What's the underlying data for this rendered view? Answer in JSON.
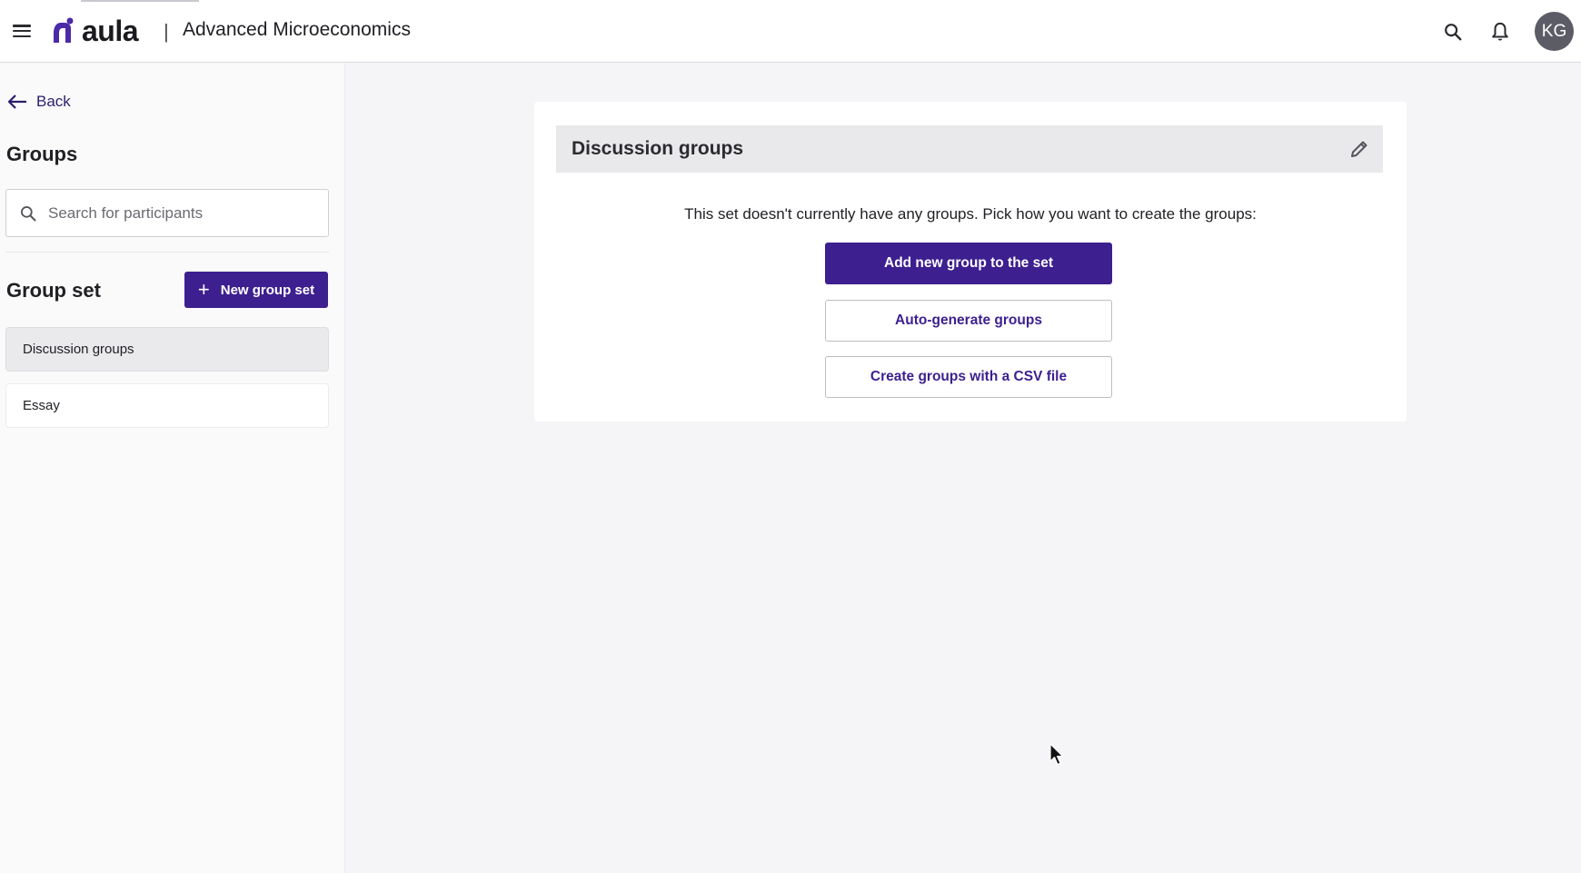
{
  "header": {
    "logo_text": "aula",
    "separator": "|",
    "course_title": "Advanced Microeconomics",
    "avatar_initials": "KG",
    "icons": [
      "menu-icon",
      "search-icon",
      "bell-icon"
    ]
  },
  "sidebar": {
    "back_label": "Back",
    "groups_heading": "Groups",
    "search_placeholder": "Search for participants",
    "group_set_heading": "Group set",
    "new_group_set_label": "New group set",
    "group_sets": [
      {
        "label": "Discussion groups",
        "selected": true
      },
      {
        "label": "Essay",
        "selected": false
      }
    ]
  },
  "main": {
    "card_title": "Discussion groups",
    "message": "This set doesn't currently have any groups. Pick how you want to create the groups:",
    "buttons": {
      "add_new": "Add new group to the set",
      "auto_generate": "Auto-generate groups",
      "csv": "Create groups with a CSV file"
    }
  },
  "colors": {
    "brand_primary": "#3d1f8f",
    "background": "#f5f5f7",
    "card_header": "#e9e9ec"
  }
}
